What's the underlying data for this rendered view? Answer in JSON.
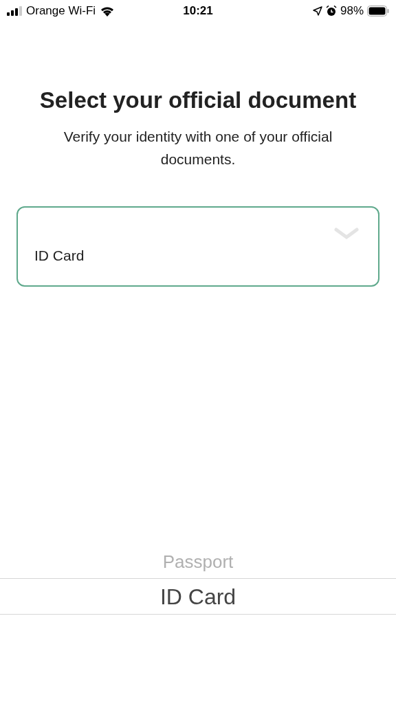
{
  "status_bar": {
    "carrier": "Orange Wi-Fi",
    "time": "10:21",
    "battery": "98%"
  },
  "title": "Select your official document",
  "subtitle": "Verify your identity with one of your official documents.",
  "document_select": {
    "value": "ID Card"
  },
  "picker": {
    "options": [
      {
        "label": "Passport",
        "selected": false
      },
      {
        "label": "ID Card",
        "selected": true
      }
    ]
  }
}
